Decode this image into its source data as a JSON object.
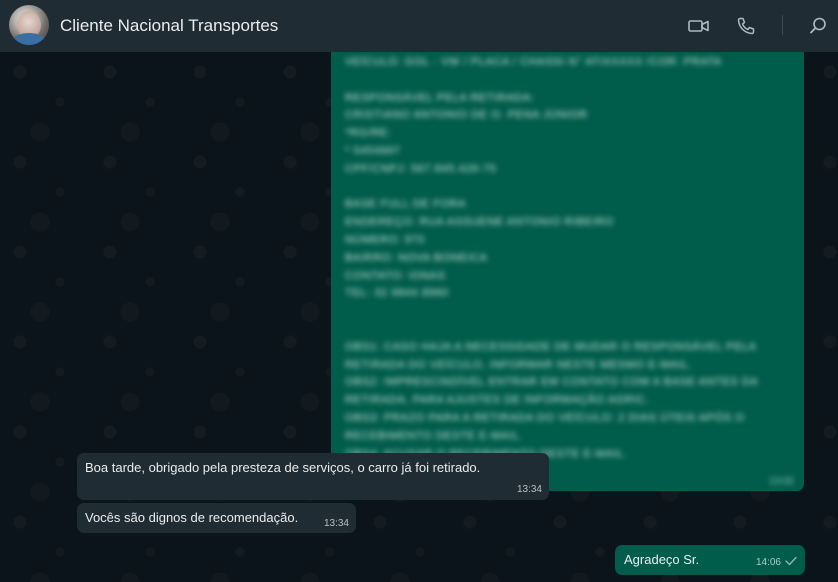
{
  "header": {
    "contact_name": "Cliente Nacional Transportes",
    "icons": [
      "video-call-icon",
      "voice-call-icon",
      "search-icon"
    ]
  },
  "blurred_message": {
    "lines": [
      "Veículo: GOL - VW / PLACA / CHASSI N° ATIXXXXX /COR: PRATA",
      "",
      "RESPONSÁVEL PELA RETIRADA:",
      "CRISTIANO ANTONIO DE O. PENA JÚNIOR",
      "*RG/RE:",
      "*     5454997",
      "CPF/CNPJ: 567.845.426-75",
      "",
      "BASE FULL DE FORA",
      "ENDEREÇO: RUA ASSUENE ANTONIO RIBEIRO",
      "NÚMERO: 970",
      "BAIRRO: NOVA BONEICA",
      "CONTATO: IONAS",
      "TEL: 32 9844 8960",
      "",
      "",
      "OBS1: CASO HAJA A NECESSIDADE DE MUDAR O RESPONSÁVEL PELA",
      "RETIRADA DO VEÍCULO, INFORMAR NESTE MESMO E-MAIL.",
      "OBS2: IMPRESCINDÍVEL ENTRAR EM CONTATO COM A BASE ANTES DA",
      "RETIRADA, PARA AJUSTES DE INFORMAÇÃO AGRIC.",
      "OBS3: PRAZO PARA A RETIRADA DO VEÍCULO: 2 DIAS ÚTEIS APÓS O",
      "RECEBIMENTO DESTE E-MAIL.",
      "OBS4: ACUSAR O RECEBIMENTO DESTE E-MAIL."
    ],
    "time": "13:02"
  },
  "messages": [
    {
      "direction": "incoming",
      "text": "Boa tarde,  obrigado pela presteza de serviços,  o carro já foi retirado.",
      "time": "13:34"
    },
    {
      "direction": "incoming",
      "text": "Vocês são dignos de recomendação.",
      "time": "13:34"
    },
    {
      "direction": "outgoing",
      "text": "Agradeço Sr.",
      "time": "14:06",
      "status_icon": "single-check-icon"
    }
  ],
  "colors": {
    "header_bg": "#202c33",
    "chat_bg": "#0b141a",
    "incoming_bubble": "#202c33",
    "outgoing_bubble": "#005c4b",
    "text": "#e9edef"
  }
}
